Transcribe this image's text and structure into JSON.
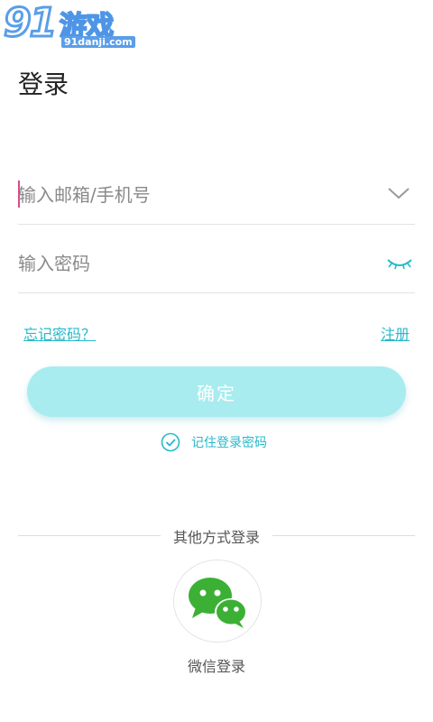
{
  "watermark": {
    "number": "91",
    "name": "游戏",
    "domain": "91danji.com"
  },
  "page": {
    "title": "登录"
  },
  "form": {
    "account_placeholder": "输入邮箱/手机号",
    "password_placeholder": "输入密码",
    "forgot_label": "忘记密码？",
    "register_label": "注册",
    "confirm_label": "确定",
    "remember_label": "记住登录密码",
    "remember_checked": true
  },
  "other_login": {
    "divider_label": "其他方式登录",
    "wechat_label": "微信登录"
  },
  "colors": {
    "accent": "#27b9c9",
    "button_bg": "#a8ecef",
    "wechat_green": "#3cb035",
    "cursor": "#d94a8a"
  },
  "icons": {
    "account_dropdown": "chevron-down-icon",
    "password_toggle": "eye-closed-icon",
    "remember": "check-circle-icon",
    "wechat": "wechat-icon"
  }
}
